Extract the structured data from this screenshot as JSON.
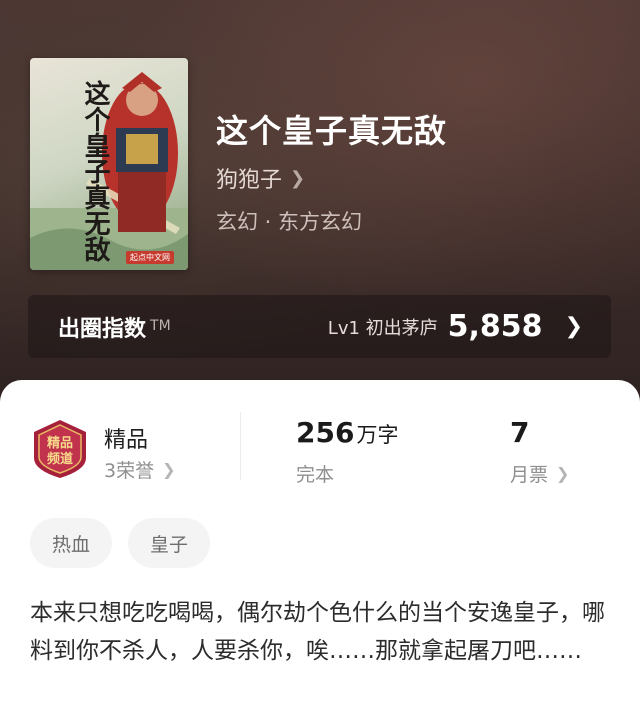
{
  "book": {
    "title": "这个皇子真无敌",
    "author": "狗狍子",
    "genre": "玄幻 · 东方玄幻",
    "cover_text": "这个皇子真无敌",
    "cover_publisher": "起点中文网"
  },
  "index_bar": {
    "label": "出圈指数",
    "tm": "TM",
    "level": "Lv1 初出茅庐",
    "value": "5,858"
  },
  "stats": {
    "quality": {
      "title": "精品",
      "sub": "3荣誉"
    },
    "words": {
      "number": "256",
      "unit": "万字",
      "sub": "完本"
    },
    "tickets": {
      "number": "7",
      "sub": "月票"
    },
    "badge_text": "精品频道"
  },
  "tags": [
    "热血",
    "皇子"
  ],
  "description": "本来只想吃吃喝喝，偶尔劫个色什么的当个安逸皇子，哪料到你不杀人，人要杀你，唉……那就拿起屠刀吧……",
  "icons": {
    "chevron": "chevron-right-icon"
  },
  "colors": {
    "hero_bg": "#3b2b29",
    "badge_red": "#a5213b"
  }
}
